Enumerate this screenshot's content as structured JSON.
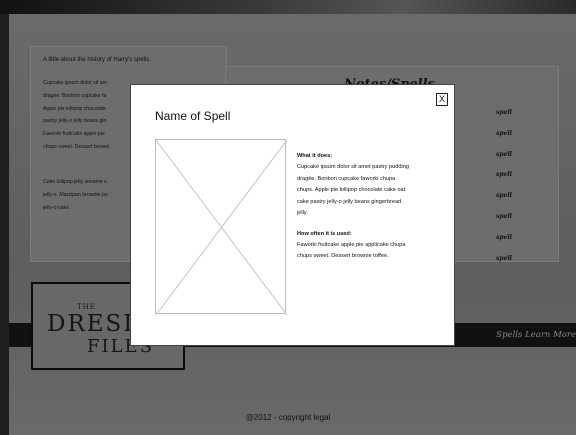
{
  "about": {
    "intro": "A little about the history of Harry's spells.",
    "para1": "Cupcake ipsum dolor sit am\ndragée. Bonbon cupcake fa\nApple pie lollipop chocolate\npastry jelly-o jelly beans gin\nFaworki fruitcake apple pie\nchups sweet. Dessert browni",
    "para2": "Cake lollipop jelly sesame s\njelly-o. Marzipan brownie pu\njelly-o cake."
  },
  "notes": {
    "title": "Notes/Spells"
  },
  "spells": [
    "spell",
    "spell",
    "spell",
    "spell",
    "spell",
    "spell",
    "spell",
    "spell"
  ],
  "logo": {
    "top": "THE",
    "middle": "DRESD",
    "bottom": "FILES"
  },
  "nav_text": "Spells   Learn More",
  "footer": "@2012 - copyright legal",
  "modal": {
    "close": "X",
    "title": "Name of Spell",
    "what_heading": "What it does:",
    "what_text": "Cupcake ipsum dolor sit amet pastry pudding\ndragée. Bonbon cupcake faworki chupa\nchups. Apple pie lollipop chocolate cake oat\ncake pastry jelly-o jelly beans gingerbread\njelly.",
    "how_heading": "How often it is used:",
    "how_text": "Faworki fruitcake apple pie applicake chupa\nchups sweet. Dessert brownie toffee."
  },
  "colors": {
    "overlay": "#6a6a6a",
    "modal_bg": "#ffffff",
    "band": "#111111"
  },
  "icons": {
    "close": "close-icon",
    "image_placeholder": "image-placeholder-icon"
  }
}
